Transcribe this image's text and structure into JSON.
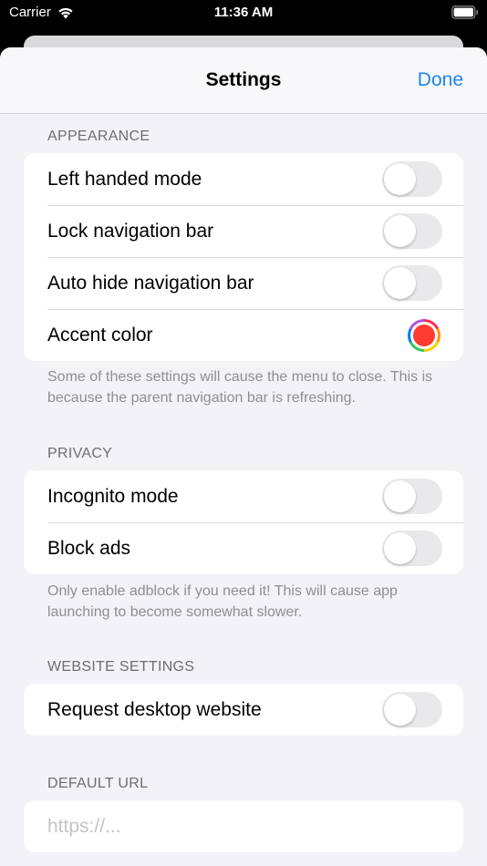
{
  "status_bar": {
    "carrier": "Carrier",
    "time": "11:36 AM"
  },
  "nav": {
    "title": "Settings",
    "done_label": "Done"
  },
  "appearance": {
    "header": "APPEARANCE",
    "rows": [
      {
        "label": "Left handed mode",
        "control": "toggle",
        "on": false
      },
      {
        "label": "Lock navigation bar",
        "control": "toggle",
        "on": false
      },
      {
        "label": "Auto hide navigation bar",
        "control": "toggle",
        "on": false
      },
      {
        "label": "Accent color",
        "control": "color-well",
        "color": "#ff3b30"
      }
    ],
    "footer": "Some of these settings will cause the menu to close. This is because the parent navigation bar is refreshing."
  },
  "privacy": {
    "header": "PRIVACY",
    "rows": [
      {
        "label": "Incognito mode",
        "control": "toggle",
        "on": false
      },
      {
        "label": "Block ads",
        "control": "toggle",
        "on": false
      }
    ],
    "footer": "Only enable adblock if you need it! This will cause app launching to become somewhat slower."
  },
  "website_settings": {
    "header": "WEBSITE SETTINGS",
    "rows": [
      {
        "label": "Request desktop website",
        "control": "toggle",
        "on": false
      }
    ]
  },
  "default_url": {
    "header": "DEFAULT URL",
    "placeholder": "https://...",
    "value": ""
  },
  "colors": {
    "accent_link": "#1d86e6",
    "accent_color": "#ff3b30",
    "toggle_off": "#e9e9eb"
  }
}
